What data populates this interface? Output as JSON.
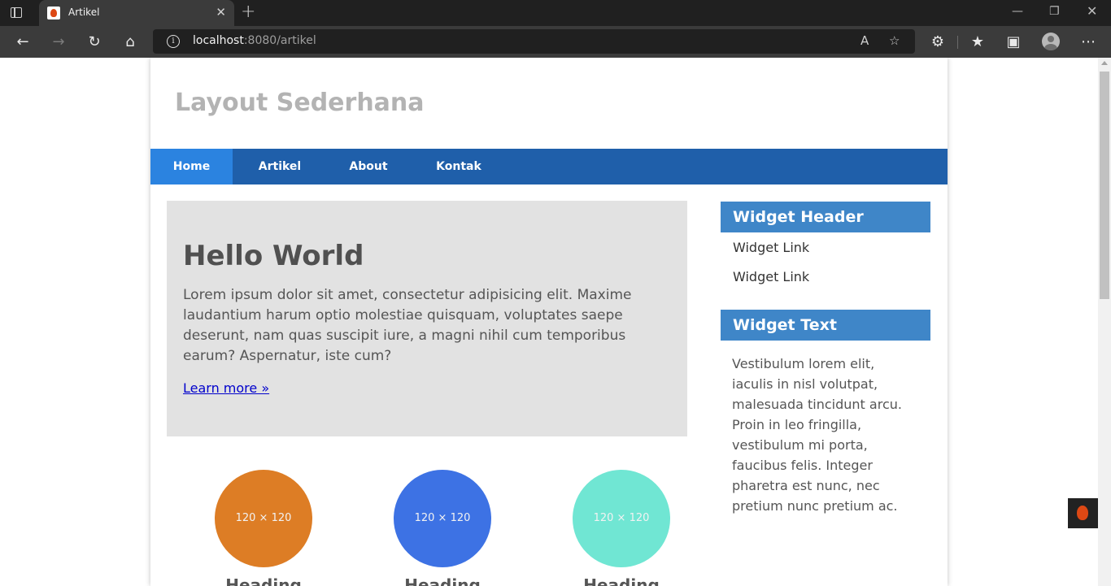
{
  "browser": {
    "tab_title": "Artikel",
    "tab_close": "✕",
    "new_tab": "+",
    "url_host": "localhost",
    "url_rest": ":8080/artikel",
    "window_controls": {
      "minimize": "—",
      "restore": "❐",
      "close": "✕"
    },
    "nav_icons": {
      "back": "←",
      "forward": "→",
      "reload": "↻",
      "home": "⌂"
    },
    "right_icons": {
      "read_aloud": "A",
      "favorite": "☆",
      "extensions": "⚙",
      "favorites": "★",
      "collections": "▣",
      "more": "⋯"
    }
  },
  "page": {
    "site_title": "Layout Sederhana",
    "nav": [
      {
        "label": "Home",
        "active": true
      },
      {
        "label": "Artikel",
        "active": false
      },
      {
        "label": "About",
        "active": false
      },
      {
        "label": "Kontak",
        "active": false
      }
    ],
    "hero": {
      "title": "Hello World",
      "text": "Lorem ipsum dolor sit amet, consectetur adipisicing elit. Maxime laudantium harum optio molestiae quisquam, voluptates saepe deserunt, nam quas suscipit iure, a magni nihil cum temporibus earum? Aspernatur, iste cum?",
      "link": "Learn more »"
    },
    "cards": [
      {
        "img_label": "120 × 120",
        "color": "#dd7d25",
        "heading": "Heading"
      },
      {
        "img_label": "120 × 120",
        "color": "#3d72e4",
        "heading": "Heading"
      },
      {
        "img_label": "120 × 120",
        "color": "#70e6d3",
        "heading": "Heading"
      }
    ],
    "sidebar": {
      "widget_header": "Widget Header",
      "links": [
        "Widget Link",
        "Widget Link"
      ],
      "widget_text_title": "Widget Text",
      "widget_text": "Vestibulum lorem elit, iaculis in nisl volutpat, malesuada tincidunt arcu. Proin in leo fringilla, vestibulum mi porta, faucibus felis. Integer pharetra est nunc, nec pretium nunc pretium ac."
    }
  },
  "colors": {
    "nav_bg": "#1f5faa",
    "nav_active": "#2b83e0",
    "widget_header": "#3f86c8",
    "hero_bg": "#e2e2e2"
  }
}
